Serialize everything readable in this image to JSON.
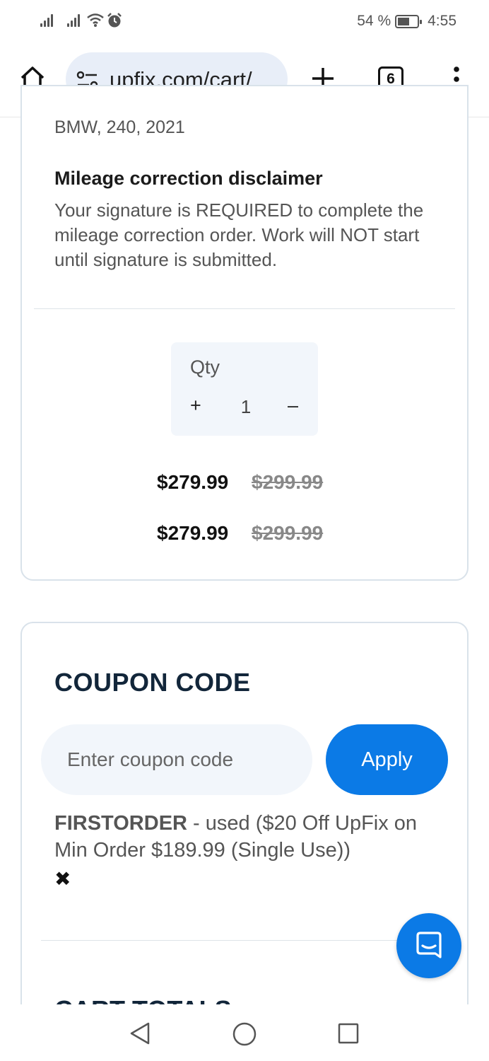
{
  "status_bar": {
    "battery_percent": "54 %",
    "time": "4:55"
  },
  "browser": {
    "url": "upfix.com/cart/",
    "tab_count": "6"
  },
  "cart_item": {
    "vehicle": "BMW, 240, 2021",
    "disclaimer_title": "Mileage correction disclaimer",
    "disclaimer_text": "Your signature is REQUIRED to complete the mileage correction order. Work will NOT start until signature is submitted.",
    "qty_label": "Qty",
    "qty_plus": "+",
    "qty_value": "1",
    "qty_minus": "–",
    "price": "$279.99",
    "old_price": "$299.99",
    "subtotal_price": "$279.99",
    "subtotal_old_price": "$299.99"
  },
  "coupon": {
    "title": "COUPON CODE",
    "input_placeholder": "Enter coupon code",
    "apply_label": "Apply",
    "used_code": "FIRSTORDER",
    "used_description": " - used ($20 Off UpFix on Min Order $189.99 (Single Use))",
    "remove_symbol": "✖"
  },
  "cart_totals": {
    "title": "CART TOTALS"
  },
  "colors": {
    "accent": "#0b7ae6",
    "heading": "#12263a",
    "card_border": "#d9e2ea",
    "field_bg": "#f2f6fb"
  }
}
